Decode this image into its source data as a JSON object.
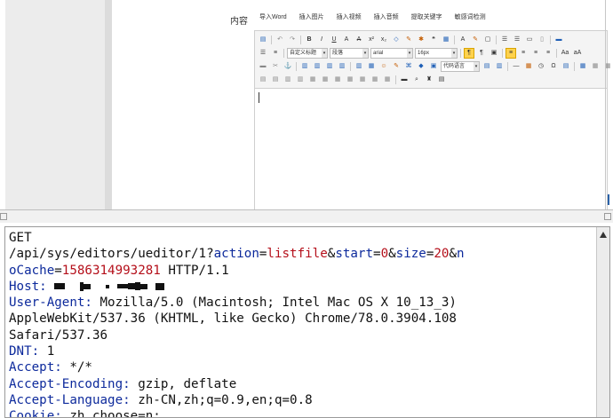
{
  "editor": {
    "content_label": "内容",
    "tabs": [
      "导入Word",
      "插入图片",
      "插入视频",
      "插入音频",
      "提取关键字",
      "敏感词检测"
    ],
    "toolbar": {
      "custom_title": "自定义标题",
      "paragraph": "段落",
      "font_family": "arial",
      "font_size": "16px",
      "code_lang": "代码语言"
    }
  },
  "request": {
    "method": "GET",
    "path_base": "/api/sys/editors/ueditor/1?",
    "params": [
      {
        "name": "action",
        "value": "listfile"
      },
      {
        "name": "start",
        "value": "0"
      },
      {
        "name": "size",
        "value": "20"
      },
      {
        "name": "noCache",
        "value": "1586314993281"
      }
    ],
    "param_n": "n",
    "param_ocache": "oCache",
    "protocol": " HTTP/1.1",
    "host_label": "Host:",
    "ua_label": "User-Agent:",
    "ua_value_line1": " Mozilla/5.0 (Macintosh; Intel Mac OS X 10_13_3)",
    "ua_value_line2": "AppleWebKit/537.36 (KHTML, like Gecko) Chrome/78.0.3904.108",
    "ua_value_line3": "Safari/537.36",
    "dnt_label": "DNT:",
    "dnt_value": " 1",
    "accept_label": "Accept:",
    "accept_value": " */*",
    "accept_encoding_label": "Accept-Encoding:",
    "accept_encoding_value": " gzip, deflate",
    "accept_language_label": "Accept-Language:",
    "accept_language_value": " zh-CN,zh;q=0.9,en;q=0.8",
    "cookie_label": "Cookie:",
    "cookie_value": " zh_choose=n;"
  }
}
